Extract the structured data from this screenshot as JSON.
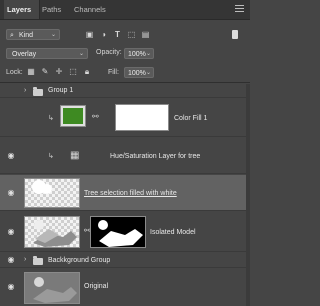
{
  "tabs": [
    {
      "label": "Layers",
      "active": true
    },
    {
      "label": "Paths",
      "active": false
    },
    {
      "label": "Channels",
      "active": false
    }
  ],
  "filter": {
    "label": "Kind",
    "icon": "search-icon"
  },
  "blend_mode": "Overlay",
  "opacity": {
    "label": "Opacity:",
    "value": "100%"
  },
  "lock": {
    "label": "Lock:"
  },
  "fill": {
    "label": "Fill:",
    "value": "100%"
  },
  "layers": [
    {
      "name": "Group 1",
      "type": "group",
      "visible": false
    },
    {
      "name": "Color Fill 1",
      "type": "fill",
      "visible": false,
      "clipped": true,
      "color": "#3e8a22"
    },
    {
      "name": "Hue/Saturation Layer for tree",
      "type": "adjustment",
      "visible": true,
      "clipped": true
    },
    {
      "name": "Tree selection filled with white",
      "type": "pixel",
      "visible": true,
      "selected": true
    },
    {
      "name": "Isolated Model",
      "type": "pixel-mask",
      "visible": true
    },
    {
      "name": "Backkground Group",
      "type": "group",
      "visible": true
    },
    {
      "name": "Original",
      "type": "pixel",
      "visible": true
    }
  ]
}
